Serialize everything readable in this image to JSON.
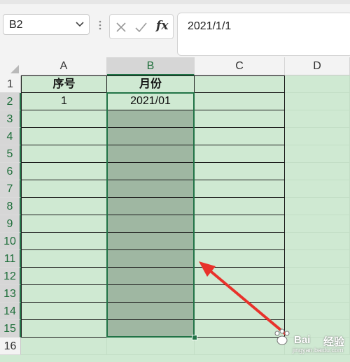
{
  "namebox": {
    "value": "B2"
  },
  "formula_bar": {
    "fx_label": "fx",
    "value": "2021/1/1"
  },
  "columns": [
    "A",
    "B",
    "C",
    "D"
  ],
  "rows": [
    "1",
    "2",
    "3",
    "4",
    "5",
    "6",
    "7",
    "8",
    "9",
    "10",
    "11",
    "12",
    "13",
    "14",
    "15",
    "16"
  ],
  "cells": {
    "A1": "序号",
    "B1": "月份",
    "A2": "1",
    "B2": "2021/01"
  },
  "watermark": {
    "brand_left": "Bai",
    "brand_right": "经验",
    "url": "jingyan.baidu.com"
  },
  "colors": {
    "grid_bg": "#cfe9d2",
    "selection_fill": "#9fb7a2",
    "selection_border": "#217346",
    "arrow": "#e8322b"
  },
  "icons": {
    "namebox_caret": "chevron-down-icon",
    "cancel": "close-icon",
    "enter": "check-icon",
    "insert_function": "fx-icon",
    "annotation": "red-arrow-icon",
    "watermark": "baidu-paw-icon"
  }
}
